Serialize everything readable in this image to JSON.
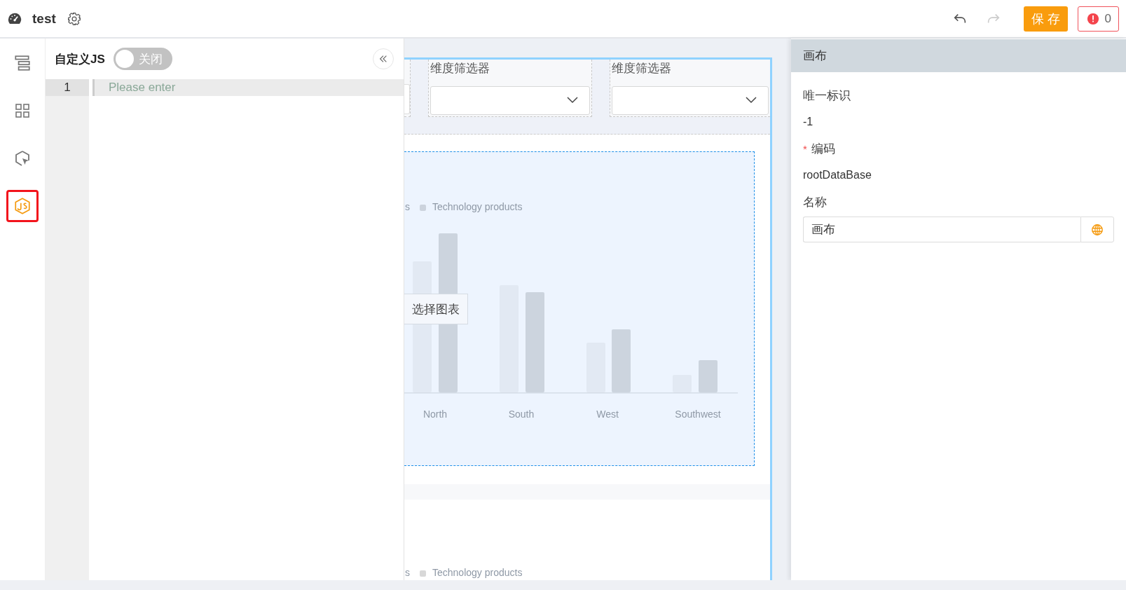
{
  "header": {
    "title": "test",
    "undo": {
      "disabled": false
    },
    "redo": {
      "disabled": true
    },
    "save_button": "保存",
    "error_count": "0"
  },
  "sidebar": {
    "items": [
      {
        "kind": "outline",
        "selected": false
      },
      {
        "kind": "grid",
        "selected": false
      },
      {
        "kind": "component",
        "selected": false
      },
      {
        "kind": "script",
        "selected": true
      }
    ]
  },
  "js_panel": {
    "title": "自定义JS",
    "toggle": {
      "on": false,
      "label": "关闭"
    },
    "editor": {
      "lines": [
        {
          "number": "1",
          "placeholder": "Please enter"
        }
      ]
    }
  },
  "canvas": {
    "filters": [
      {
        "label": "维度筛选器"
      },
      {
        "label": "维度筛选器"
      }
    ],
    "chart": {
      "legend_cut": "s",
      "legend": "Technology products",
      "categories": [
        "North",
        "South",
        "West",
        "Southwest"
      ],
      "overlay_button": "选择图表"
    },
    "chart_2": {
      "legend_cut": "s",
      "legend": "Technology products"
    }
  },
  "properties": {
    "title": "画布",
    "fields": [
      {
        "kind": "text",
        "label": "唯一标识",
        "value": "-1"
      },
      {
        "kind": "text",
        "label": "编码",
        "value": "rootDataBase",
        "marker": "*"
      },
      {
        "kind": "input",
        "label": "名称",
        "value": "画布"
      }
    ]
  }
}
